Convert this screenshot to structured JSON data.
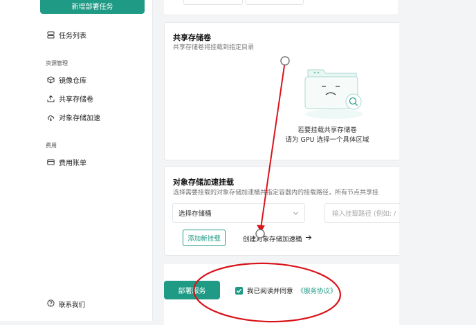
{
  "sidebar": {
    "deploy_task_label": "新增部署任务",
    "task_list_label": "任务列表",
    "resource_section": "资源管理",
    "image_repo_label": "镜像仓库",
    "shared_storage_label": "共享存储卷",
    "object_storage_label": "对象存储加速",
    "billing_section": "费用",
    "billing_label": "费用账单",
    "contact_label": "联系我们"
  },
  "shared_storage": {
    "title": "共享存储卷",
    "subtitle": "共享存储卷将挂载到指定目录",
    "empty_line1": "若要挂载共享存储卷",
    "empty_line2": "请为 GPU 选择一个具体区域"
  },
  "object_storage": {
    "title": "对象存储加速挂载",
    "subtitle": "选择需要挂载的对象存储加速桶并指定容器内的挂载路径，所有节点共享挂",
    "select_placeholder": "选择存储桶",
    "mount_path_placeholder": "输入挂载路径 (例如: /",
    "add_mount_label": "添加新挂载",
    "create_link_label": "创建对象存储加速桶"
  },
  "footer": {
    "deploy_label": "部署服务",
    "agree_text": "我已阅读并同意",
    "agree_link": "《服务协议》",
    "agree_checked": true
  },
  "colors": {
    "accent": "#1f9a85",
    "annotation": "#d9141b"
  },
  "icons": [
    "list-icon",
    "cube-icon",
    "upload-icon",
    "cloud-icon",
    "card-icon",
    "help-circle-icon",
    "chevron-down-icon",
    "arrow-right-icon",
    "check-icon",
    "folder-empty-illustration"
  ]
}
